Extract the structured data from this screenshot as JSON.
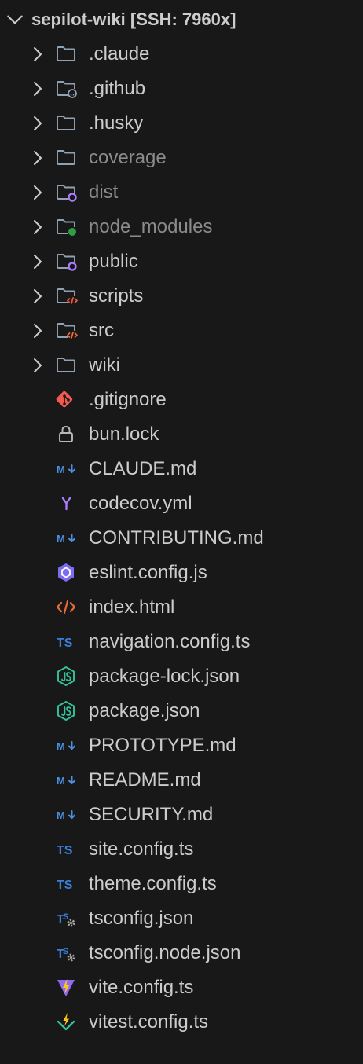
{
  "explorer": {
    "root_label": "sepilot-wiki [SSH: 7960x]",
    "items": [
      {
        "label": ".claude",
        "kind": "folder",
        "icon": "folder-icon",
        "dim": false
      },
      {
        "label": ".github",
        "kind": "folder",
        "icon": "folder-github-icon",
        "dim": false
      },
      {
        "label": ".husky",
        "kind": "folder",
        "icon": "folder-icon",
        "dim": false
      },
      {
        "label": "coverage",
        "kind": "folder",
        "icon": "folder-icon",
        "dim": true
      },
      {
        "label": "dist",
        "kind": "folder",
        "icon": "folder-dist-icon",
        "dim": true
      },
      {
        "label": "node_modules",
        "kind": "folder",
        "icon": "folder-node-icon",
        "dim": true
      },
      {
        "label": "public",
        "kind": "folder",
        "icon": "folder-public-icon",
        "dim": false
      },
      {
        "label": "scripts",
        "kind": "folder",
        "icon": "folder-scripts-icon",
        "dim": false
      },
      {
        "label": "src",
        "kind": "folder",
        "icon": "folder-src-icon",
        "dim": false
      },
      {
        "label": "wiki",
        "kind": "folder",
        "icon": "folder-icon",
        "dim": false
      },
      {
        "label": ".gitignore",
        "kind": "file",
        "icon": "git-icon",
        "dim": false
      },
      {
        "label": "bun.lock",
        "kind": "file",
        "icon": "lock-icon",
        "dim": false
      },
      {
        "label": "CLAUDE.md",
        "kind": "file",
        "icon": "markdown-icon",
        "dim": false
      },
      {
        "label": "codecov.yml",
        "kind": "file",
        "icon": "yaml-icon",
        "dim": false
      },
      {
        "label": "CONTRIBUTING.md",
        "kind": "file",
        "icon": "markdown-icon",
        "dim": false
      },
      {
        "label": "eslint.config.js",
        "kind": "file",
        "icon": "eslint-icon",
        "dim": false
      },
      {
        "label": "index.html",
        "kind": "file",
        "icon": "html-icon",
        "dim": false
      },
      {
        "label": "navigation.config.ts",
        "kind": "file",
        "icon": "typescript-icon",
        "dim": false
      },
      {
        "label": "package-lock.json",
        "kind": "file",
        "icon": "nodejs-icon",
        "dim": false
      },
      {
        "label": "package.json",
        "kind": "file",
        "icon": "nodejs-icon",
        "dim": false
      },
      {
        "label": "PROTOTYPE.md",
        "kind": "file",
        "icon": "markdown-icon",
        "dim": false
      },
      {
        "label": "README.md",
        "kind": "file",
        "icon": "markdown-icon",
        "dim": false
      },
      {
        "label": "SECURITY.md",
        "kind": "file",
        "icon": "markdown-icon",
        "dim": false
      },
      {
        "label": "site.config.ts",
        "kind": "file",
        "icon": "typescript-icon",
        "dim": false
      },
      {
        "label": "theme.config.ts",
        "kind": "file",
        "icon": "typescript-icon",
        "dim": false
      },
      {
        "label": "tsconfig.json",
        "kind": "file",
        "icon": "tsconfig-icon",
        "dim": false
      },
      {
        "label": "tsconfig.node.json",
        "kind": "file",
        "icon": "tsconfig-icon",
        "dim": false
      },
      {
        "label": "vite.config.ts",
        "kind": "file",
        "icon": "vite-icon",
        "dim": false
      },
      {
        "label": "vitest.config.ts",
        "kind": "file",
        "icon": "vitest-icon",
        "dim": false
      }
    ]
  },
  "colors": {
    "background": "#181818",
    "text": "#cccccc",
    "text_dim": "#8b8b8b",
    "folder_outline": "#8fa1b3",
    "git": "#f05a50",
    "markdown": "#4a8fe0",
    "yaml": "#a97bff",
    "eslint": "#7c6cf0",
    "html": "#e8693a",
    "typescript": "#3a7fd6",
    "nodejs": "#3fb950",
    "node_badge": "#2ea043",
    "dist_badge": "#a97bff",
    "scripts_badge": "#e35b3c",
    "src_badge": "#e8693a",
    "vite_purple": "#8e6cf2",
    "vite_yellow": "#ffc61a",
    "vitest_green": "#34c29a"
  }
}
